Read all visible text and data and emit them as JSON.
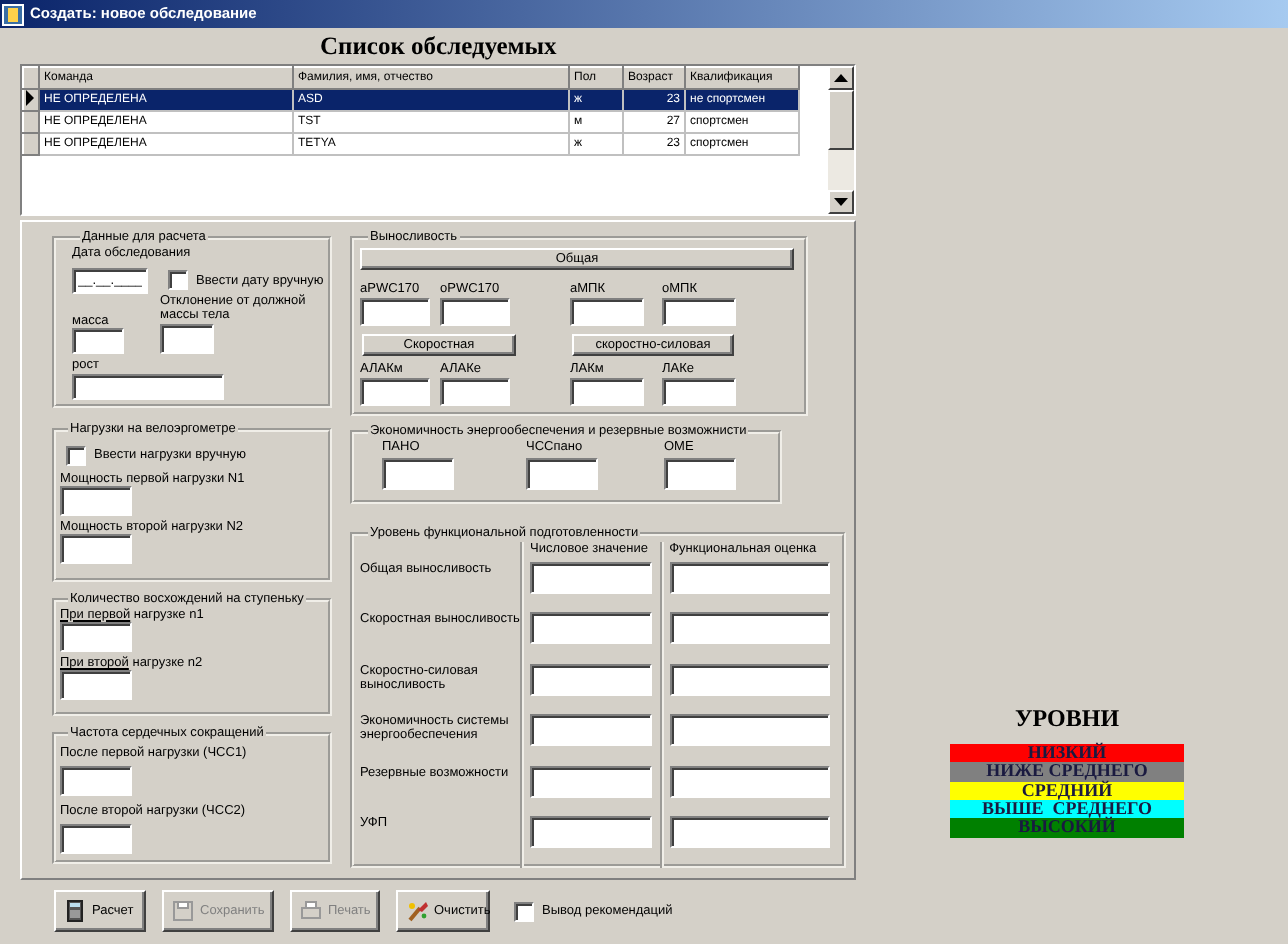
{
  "window": {
    "title": "Создать: новое обследование"
  },
  "list_title": "Список обследуемых",
  "table": {
    "columns": [
      "Команда",
      "Фамилия, имя, отчество",
      "Пол",
      "Возраст",
      "Квалификация"
    ],
    "rows": [
      {
        "selected": true,
        "cells": [
          "НЕ ОПРЕДЕЛЕНА",
          "ASD",
          "ж",
          "23",
          "не спортсмен"
        ]
      },
      {
        "selected": false,
        "cells": [
          "НЕ ОПРЕДЕЛЕНА",
          "TST",
          "м",
          "27",
          "спортсмен"
        ]
      },
      {
        "selected": false,
        "cells": [
          "НЕ ОПРЕДЕЛЕНА",
          "TETYA",
          "ж",
          "23",
          "спортсмен"
        ]
      }
    ]
  },
  "calc_group": {
    "title": "Данные для расчета",
    "date_label": "Дата обследования",
    "date_value": "__.__.____",
    "manual_date": {
      "label": "Ввести дату вручную",
      "checked": false
    },
    "mass_label": "масса",
    "deviation_label": "Отклонение от должной массы тела",
    "height_label": "рост"
  },
  "load_group": {
    "title": "Нагрузки на велоэргометре",
    "manual_load": {
      "label": "Ввести нагрузки вручную",
      "checked": false
    },
    "fields": [
      "Мощность первой нагрузки N1",
      "Мощность второй нагрузки N2"
    ]
  },
  "steps_group": {
    "title": "Количество восхождений на ступеньку",
    "fields": [
      {
        "underlined": "При первой",
        "rest": "нагрузке n1"
      },
      {
        "underlined": "При второй",
        "rest": "нагрузке n2"
      }
    ]
  },
  "hr_group": {
    "title": "Частота сердечных сокращений",
    "fields": [
      "После первой нагрузки (ЧСС1)",
      "После второй нагрузки (ЧСС2)"
    ]
  },
  "endurance_group": {
    "title": "Выносливость",
    "general_button": "Общая",
    "general_fields": [
      "aPWC170",
      "oPWC170",
      "аМПК",
      "оМПК"
    ],
    "speed_button": "Скоростная",
    "power_button": "скоростно-силовая",
    "speed_fields": [
      "АЛАКм",
      "АЛАКе",
      "ЛАКм",
      "ЛАКе"
    ]
  },
  "economy_group": {
    "title": "Экономичность энергообеспечения и резервные возможнисти",
    "fields": [
      "ПАНО",
      "ЧССпано",
      "ОМЕ"
    ]
  },
  "level_group": {
    "title": "Уровень функциональной подготовленности",
    "columns": [
      "Числовое значение",
      "Функциональная оценка"
    ],
    "rows": [
      "Общая выносливость",
      "Скоростная выносливость",
      "Скоростно-силовая выносливость",
      "Экономичность системы энергообеспечения",
      "Резервные возможности",
      "УФП"
    ]
  },
  "buttons": [
    {
      "label": "Расчет",
      "disabled": false
    },
    {
      "label": "Сохранить",
      "disabled": true
    },
    {
      "label": "Печать",
      "disabled": true
    },
    {
      "label": "Очистить",
      "disabled": false
    }
  ],
  "recommendations": {
    "label": "Вывод рекомендаций",
    "checked": false
  },
  "levels": {
    "title": "УРОВНИ",
    "items": [
      {
        "label": "НИЗКИЙ",
        "color": "#ff0000"
      },
      {
        "label": "НИЖЕ СРЕДНЕГО",
        "color": "#808080"
      },
      {
        "label": "СРЕДНИЙ",
        "color": "#ffff00"
      },
      {
        "label": "ВЫШЕ  СРЕДНЕГО",
        "color": "#00ffff"
      },
      {
        "label": "ВЫСОКИЙ",
        "color": "#008000"
      }
    ]
  }
}
